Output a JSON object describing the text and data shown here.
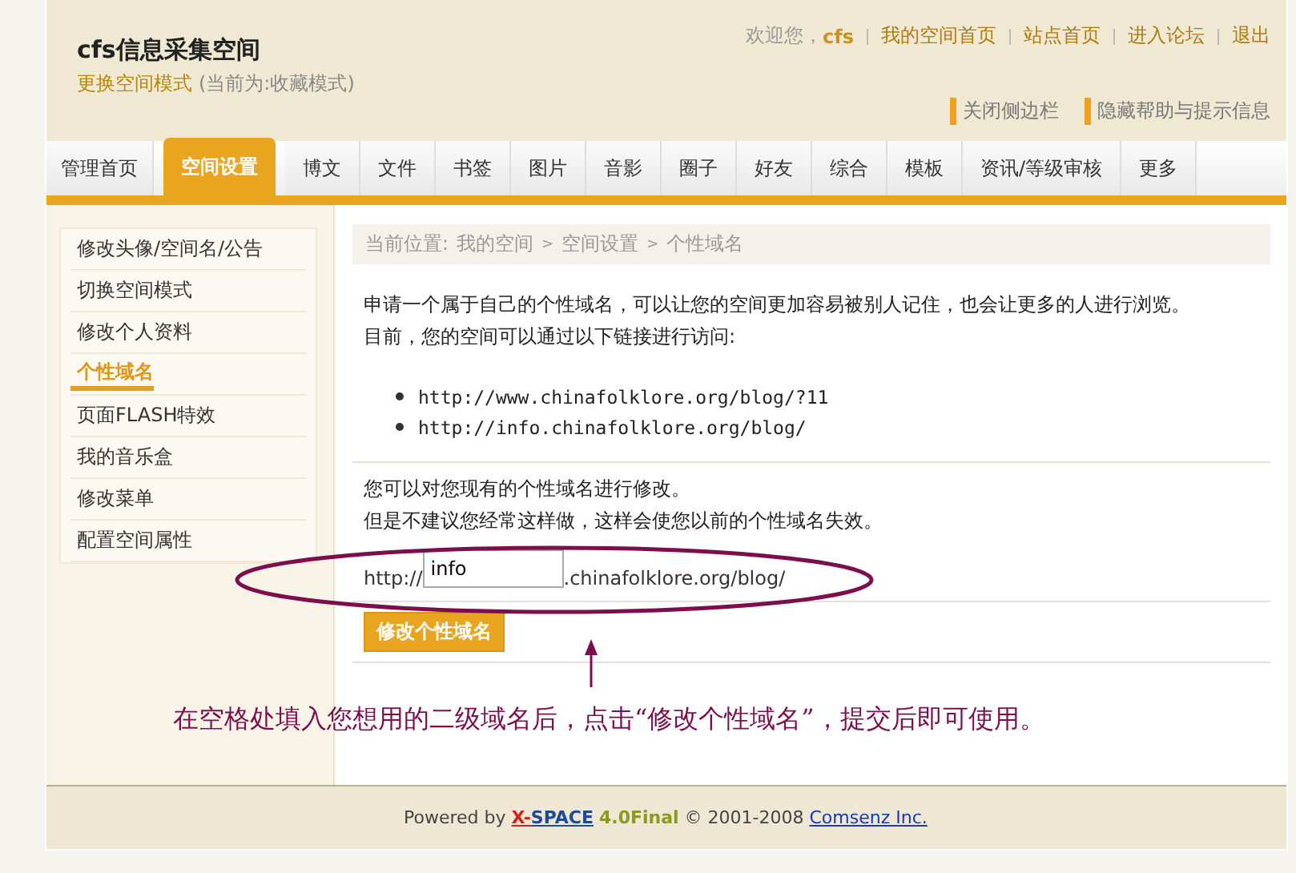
{
  "header": {
    "title": "cfs信息采集空间",
    "mode_link": "更换空间模式",
    "mode_current": "(当前为:收藏模式)",
    "welcome": "欢迎您，",
    "username": "cfs",
    "links": [
      "我的空间首页",
      "站点首页",
      "进入论坛",
      "退出"
    ],
    "toggles": [
      "关闭侧边栏",
      "隐藏帮助与提示信息"
    ]
  },
  "tabs": [
    {
      "label": "管理首页",
      "selected": false
    },
    {
      "label": "空间设置",
      "selected": true
    },
    {
      "label": "博文",
      "selected": false
    },
    {
      "label": "文件",
      "selected": false
    },
    {
      "label": "书签",
      "selected": false
    },
    {
      "label": "图片",
      "selected": false
    },
    {
      "label": "音影",
      "selected": false
    },
    {
      "label": "圈子",
      "selected": false
    },
    {
      "label": "好友",
      "selected": false
    },
    {
      "label": "综合",
      "selected": false
    },
    {
      "label": "模板",
      "selected": false
    },
    {
      "label": "资讯/等级审核",
      "selected": false
    },
    {
      "label": "更多",
      "selected": false
    }
  ],
  "sidebar": {
    "items": [
      {
        "label": "修改头像/空间名/公告",
        "selected": false
      },
      {
        "label": "切换空间模式",
        "selected": false
      },
      {
        "label": "修改个人资料",
        "selected": false
      },
      {
        "label": "个性域名",
        "selected": true
      },
      {
        "label": "页面FLASH特效",
        "selected": false
      },
      {
        "label": "我的音乐盒",
        "selected": false
      },
      {
        "label": "修改菜单",
        "selected": false
      },
      {
        "label": "配置空间属性",
        "selected": false
      }
    ]
  },
  "breadcrumb": {
    "label": "当前位置:",
    "separator": ">",
    "items": [
      "我的空间",
      "空间设置",
      "个性域名"
    ]
  },
  "intro": [
    "申请一个属于自己的个性域名，可以让您的空间更加容易被别人记住，也会让更多的人进行浏览。",
    "目前，您的空间可以通过以下链接进行访问:"
  ],
  "urls": [
    "http://www.chinafolklore.org/blog/?11",
    "http://info.chinafolklore.org/blog/"
  ],
  "notice": [
    "您可以对您现有的个性域名进行修改。",
    "但是不建议您经常这样做，这样会使您以前的个性域名失效。"
  ],
  "domain_form": {
    "prefix": "http://",
    "value": "info",
    "suffix": ".chinafolklore.org/blog/",
    "button": "修改个性域名"
  },
  "annotation": "在空格处填入您想用的二级域名后，点击“修改个性域名”，提交后即可使用。",
  "footer": {
    "powered_by": "Powered by",
    "brand_first": "X-",
    "brand_second": "SPACE",
    "version": "4.0Final",
    "copyright": "© 2001-2008",
    "company": "Comsenz Inc."
  }
}
